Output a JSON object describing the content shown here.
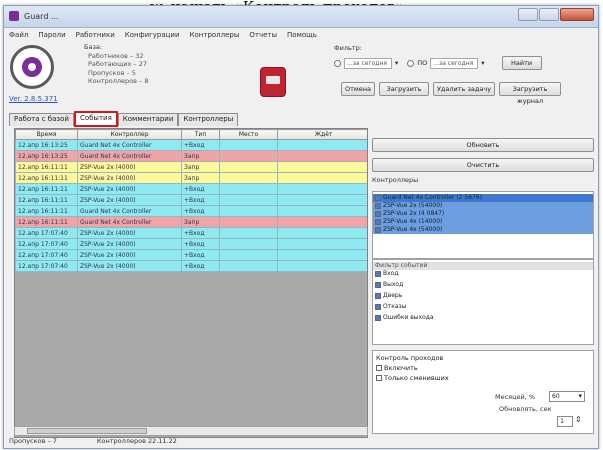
{
  "caption": "w, нажать «Контроль проходов»",
  "window": {
    "title": "Guard ... ",
    "controls": [
      "minimize",
      "maximize",
      "close"
    ]
  },
  "menu": [
    "Файл",
    "Пароли",
    "Работники",
    "Конфигурации",
    "Контроллеры",
    "Отчеты",
    "Помощь"
  ],
  "header": {
    "version": "Ver. 2.8.5.371",
    "stats_title": "База:",
    "stats": [
      "Работников – 32",
      "Работающих – 27",
      "Пропусков – 5",
      "Контроллеров – 8"
    ]
  },
  "filter": {
    "label": "Фильтр:",
    "from_value": "...за сегодня",
    "to_label": "ПО",
    "to_value": "...за сегодня",
    "find_label": "Найти",
    "buttons": [
      "Отмена",
      "Загрузить",
      "Удалить задачу",
      "Загрузить журнал"
    ]
  },
  "tabs": [
    "Работа с базой",
    "События",
    "Комментарии",
    "Контроллеры"
  ],
  "active_tab": 1,
  "table": {
    "columns": [
      "Время",
      "Контроллер",
      "Тип",
      "Место",
      "Ждёт"
    ],
    "rows": [
      {
        "color": "cyan",
        "cells": [
          "12.апр 16:13:25",
          "Guard Net 4x Controller",
          "+Вход",
          "",
          ""
        ]
      },
      {
        "color": "red",
        "cells": [
          "12.апр 16:13:25",
          "Guard Net 4x Controller",
          "Запр",
          "",
          ""
        ]
      },
      {
        "color": "yellow",
        "cells": [
          "12.апр 16:11:11",
          "ZSP-Vue 2x (4000)",
          "Запр",
          "",
          ""
        ]
      },
      {
        "color": "yellow",
        "cells": [
          "12.апр 16:11:11",
          "ZSP-Vue 2x (4000)",
          "Запр",
          "",
          ""
        ]
      },
      {
        "color": "cyan",
        "cells": [
          "12.апр 16:11:11",
          "ZSP-Vue 2x (4000)",
          "+Вход",
          "",
          ""
        ]
      },
      {
        "color": "cyan",
        "cells": [
          "12.апр 16:11:11",
          "ZSP-Vue 2x (4000)",
          "+Вход",
          "",
          ""
        ]
      },
      {
        "color": "cyan",
        "cells": [
          "12.апр 16:11:11",
          "Guard Net 4x Controller",
          "+Вход",
          "",
          ""
        ]
      },
      {
        "color": "red",
        "cells": [
          "12.апр 16:11:11",
          "Guard Net 4x Controller",
          "Запр",
          "",
          ""
        ]
      },
      {
        "color": "cyan",
        "cells": [
          "12.апр 17:07:40",
          "ZSP-Vue 2x (4000)",
          "+Вход",
          "",
          ""
        ]
      },
      {
        "color": "cyan",
        "cells": [
          "12.апр 17:07:40",
          "ZSP-Vue 2x (4000)",
          "+Вход",
          "",
          ""
        ]
      },
      {
        "color": "cyan",
        "cells": [
          "12.апр 17:07:40",
          "ZSP-Vue 2x (4000)",
          "+Вход",
          "",
          ""
        ]
      },
      {
        "color": "cyan",
        "cells": [
          "12.апр 17:07:40",
          "ZSP-Vue 2x (4000)",
          "+Вход",
          "",
          ""
        ]
      }
    ]
  },
  "status": [
    "Пропусков – 7",
    "Контроллеров 22.11.22"
  ],
  "side": {
    "refresh_label": "Обновить",
    "clear_label": "Очистить",
    "controllers_label": "Контроллеры",
    "controllers": [
      "Guard Net 4x Controller (2 5676)",
      "ZSP-Vue 2x (54000)",
      "ZSP-Vue 2x (4 0847)",
      "ZSP-Vue 4x (14000)",
      "ZSP-Vue 4x (54000)"
    ],
    "events_label": "Фильтр событий",
    "events": [
      "Вход",
      "Выход",
      "Дверь",
      "Отказы",
      "Ошибки выхода"
    ],
    "control_title": "Контроль проходов",
    "control_options": [
      "Включить",
      "Только сменивших"
    ],
    "interval_label": "Месяцей, %",
    "interval_value": "60",
    "refresh_every_label": "Обновлять, сек",
    "refresh_every_value": "1"
  }
}
